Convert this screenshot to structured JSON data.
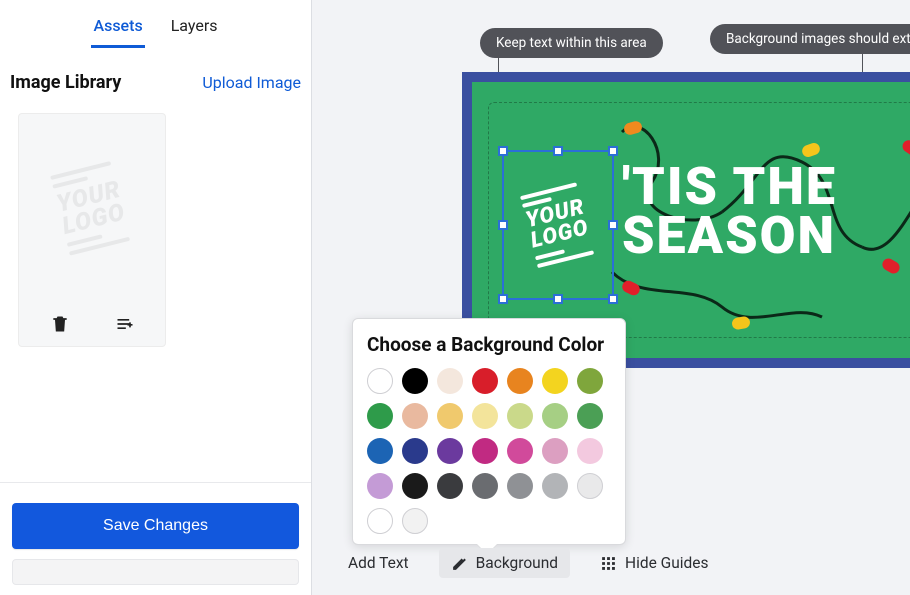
{
  "tabs": {
    "assets": "Assets",
    "layers": "Layers"
  },
  "library": {
    "title": "Image Library",
    "upload": "Upload Image"
  },
  "asset": {
    "logo_top": "YOUR",
    "logo_bottom": "LOGO"
  },
  "icons": {
    "trash": "trash-icon",
    "add_layer": "add-layer-icon"
  },
  "buttons": {
    "save": "Save Changes"
  },
  "tooltips": {
    "safe_area": "Keep text within this area",
    "bleed": "Background images should exten"
  },
  "canvas": {
    "logo_top": "YOUR",
    "logo_bottom": "LOGO",
    "headline_l1": "'TIS THE",
    "headline_l2": "SEASON"
  },
  "popover": {
    "title": "Choose a Background Color",
    "colors": [
      "#ffffff",
      "#000000",
      "#f4e7dd",
      "#d81e2a",
      "#e8841f",
      "#f3d41f",
      "#7fa63c",
      "#2e9b4a",
      "#e9b99f",
      "#f0c96d",
      "#f3e49b",
      "#cad98a",
      "#a6cf84",
      "#4b9f55",
      "#1c64b4",
      "#2a3a8c",
      "#6b3a9e",
      "#c12a82",
      "#d14a9b",
      "#dc9fc1",
      "#f3c9df",
      "#c49bd6",
      "#1a1a1a",
      "#3a3b3e",
      "#6a6c70",
      "#8f9195",
      "#b2b4b7",
      "#e9e9ea",
      "#ffffff",
      "#f2f2f2"
    ]
  },
  "toolbar": {
    "add_text": "Add Text",
    "background": "Background",
    "hide_guides": "Hide Guides"
  }
}
